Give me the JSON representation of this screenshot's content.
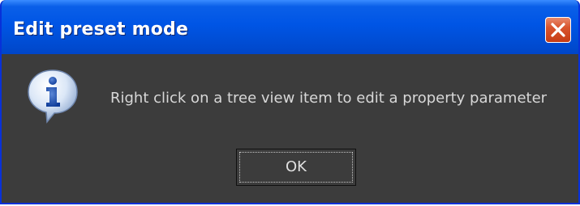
{
  "dialog": {
    "title": "Edit preset mode",
    "message": "Right click on a tree view item to edit a property parameter",
    "ok_label": "OK",
    "icon": "info-icon",
    "close_icon": "close-icon"
  },
  "colors": {
    "titlebar": "#0055e5",
    "body_background": "#3c3c3c",
    "close_button": "#d9552e",
    "message_text": "#d8d8d8"
  }
}
